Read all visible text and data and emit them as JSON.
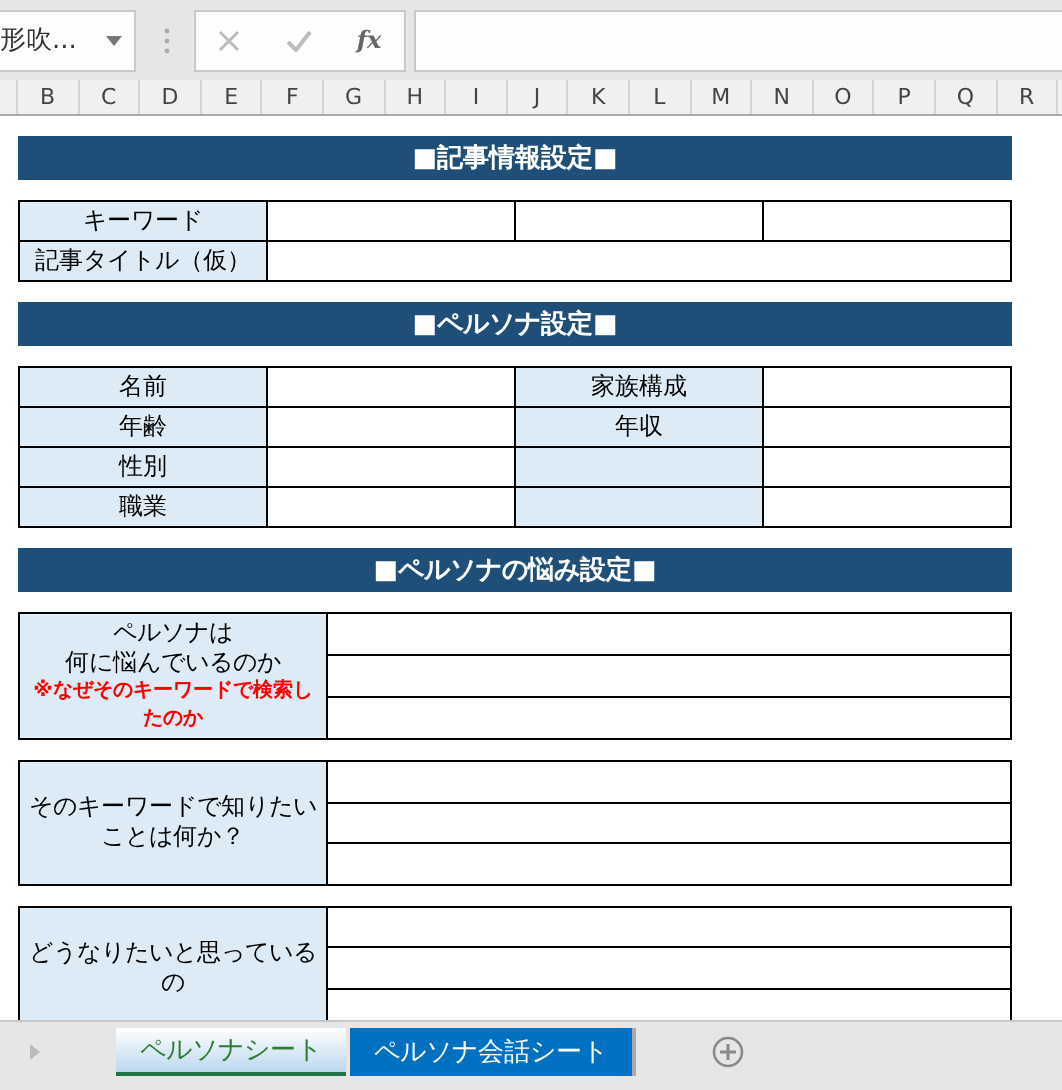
{
  "name_box": {
    "value": "形吹..."
  },
  "formula_bar": {
    "function_label": "fx"
  },
  "columns": [
    "B",
    "C",
    "D",
    "E",
    "F",
    "G",
    "H",
    "I",
    "J",
    "K",
    "L",
    "M",
    "N",
    "O",
    "P",
    "Q",
    "R"
  ],
  "sections": [
    {
      "title": "■記事情報設定■",
      "kind": "grid",
      "rows": [
        {
          "cells": [
            {
              "kind": "label",
              "text": "キーワード"
            },
            {
              "kind": "input"
            },
            {
              "kind": "input"
            },
            {
              "kind": "input"
            }
          ]
        },
        {
          "cells": [
            {
              "kind": "label",
              "text": "記事タイトル（仮）"
            },
            {
              "kind": "wide_input"
            }
          ]
        }
      ]
    },
    {
      "title": "■ペルソナ設定■",
      "kind": "grid",
      "rows": [
        {
          "cells": [
            {
              "kind": "label",
              "text": "名前"
            },
            {
              "kind": "input"
            },
            {
              "kind": "label",
              "text": "家族構成"
            },
            {
              "kind": "input"
            }
          ]
        },
        {
          "cells": [
            {
              "kind": "label",
              "text": "年齢"
            },
            {
              "kind": "input"
            },
            {
              "kind": "label",
              "text": "年収"
            },
            {
              "kind": "input"
            }
          ]
        },
        {
          "cells": [
            {
              "kind": "label",
              "text": "性別"
            },
            {
              "kind": "input"
            },
            {
              "kind": "label"
            },
            {
              "kind": "input"
            }
          ]
        },
        {
          "cells": [
            {
              "kind": "label",
              "text": "職業"
            },
            {
              "kind": "input"
            },
            {
              "kind": "label"
            },
            {
              "kind": "input"
            }
          ]
        }
      ]
    },
    {
      "title": "■ペルソナの悩み設定■",
      "kind": "questions",
      "questions": [
        {
          "lines": [
            "ペルソナは",
            "何に悩んでいるのか"
          ],
          "note": "※なぜそのキーワードで検索したのか"
        },
        {
          "lines": [
            "そのキーワードで知りたいことは何か？"
          ]
        },
        {
          "lines": [
            "どうなりたいと思っているの"
          ]
        }
      ]
    }
  ],
  "sheet_tabs": [
    {
      "label": "ペルソナシート",
      "selected": true
    },
    {
      "label": "ペルソナ会話シート",
      "selected": false
    }
  ]
}
